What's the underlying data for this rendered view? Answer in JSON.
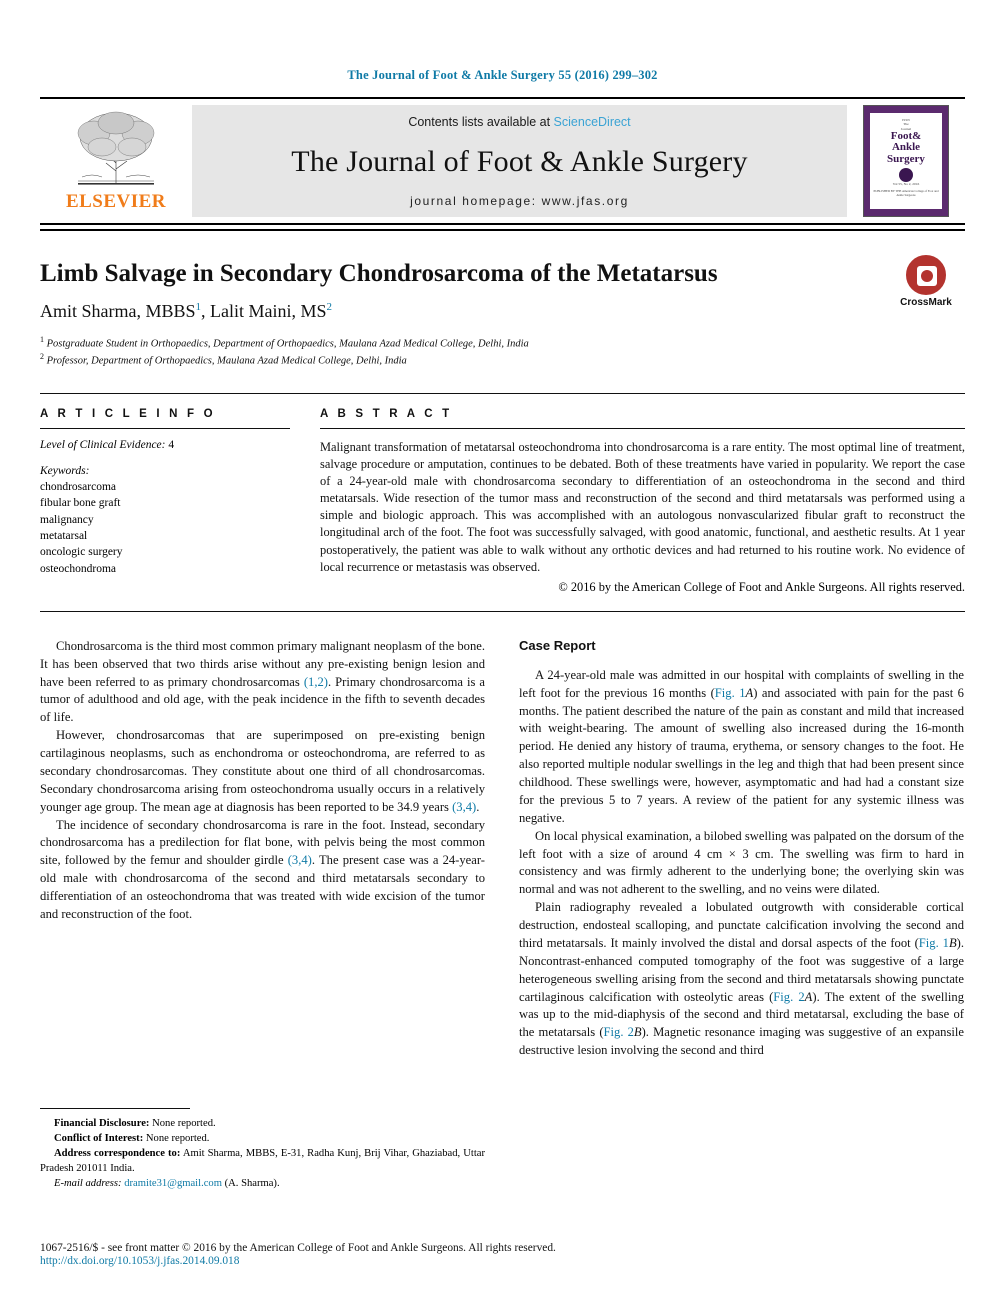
{
  "running_head": "The Journal of Foot & Ankle Surgery 55 (2016) 299–302",
  "masthead": {
    "publisher": "ELSEVIER",
    "contents_prefix": "Contents lists available at ",
    "contents_link": "ScienceDirect",
    "journal_title": "The Journal of Foot & Ankle Surgery",
    "homepage": "journal homepage: www.jfas.org",
    "cover": {
      "line_top": "ISSN",
      "t1": "The",
      "t2": "Journal",
      "t3": "of",
      "t4": "Foot&",
      "t5": "Ankle",
      "t6": "Surgery",
      "volume": "Vol 55, No 2, 2016",
      "footer": "PUBLISHED BY THE\nAmerican College of Foot and Ankle Surgeons"
    }
  },
  "article": {
    "title": "Limb Salvage in Secondary Chondrosarcoma of the Metatarsus",
    "authors_1": "Amit Sharma, MBBS",
    "authors_sup1": "1",
    "authors_sep": ", Lalit Maini, MS",
    "authors_sup2": "2",
    "affiliation_1_sup": "1",
    "affiliation_1": "Postgraduate Student in Orthopaedics, Department of Orthopaedics, Maulana Azad Medical College, Delhi, India",
    "affiliation_2_sup": "2",
    "affiliation_2": "Professor, Department of Orthopaedics, Maulana Azad Medical College, Delhi, India",
    "crossmark_label": "CrossMark"
  },
  "article_info": {
    "heading": "A R T I C L E   I N F O",
    "level_label": "Level of Clinical Evidence:",
    "level_value": " 4",
    "keywords_label": "Keywords:",
    "keywords": [
      "chondrosarcoma",
      "fibular bone graft",
      "malignancy",
      "metatarsal",
      "oncologic surgery",
      "osteochondroma"
    ]
  },
  "abstract": {
    "heading": "A B S T R A C T",
    "text": "Malignant transformation of metatarsal osteochondroma into chondrosarcoma is a rare entity. The most optimal line of treatment, salvage procedure or amputation, continues to be debated. Both of these treatments have varied in popularity. We report the case of a 24-year-old male with chondrosarcoma secondary to differentiation of an osteochondroma in the second and third metatarsals. Wide resection of the tumor mass and reconstruction of the second and third metatarsals was performed using a simple and biologic approach. This was accomplished with an autologous nonvascularized fibular graft to reconstruct the longitudinal arch of the foot. The foot was successfully salvaged, with good anatomic, functional, and aesthetic results. At 1 year postoperatively, the patient was able to walk without any orthotic devices and had returned to his routine work. No evidence of local recurrence or metastasis was observed.",
    "copyright": "© 2016 by the American College of Foot and Ankle Surgeons. All rights reserved."
  },
  "body": {
    "left_col": {
      "p1_a": "Chondrosarcoma is the third most common primary malignant neoplasm of the bone. It has been observed that two thirds arise without any pre-existing benign lesion and have been referred to as primary chondrosarcomas ",
      "p1_ref": "(1,2)",
      "p1_b": ". Primary chondrosarcoma is a tumor of adulthood and old age, with the peak incidence in the fifth to seventh decades of life.",
      "p2_a": "However, chondrosarcomas that are superimposed on pre-existing benign cartilaginous neoplasms, such as enchondroma or osteochondroma, are referred to as secondary chondrosarcomas. They constitute about one third of all chondrosarcomas. Secondary chondrosarcoma arising from osteochondroma usually occurs in a relatively younger age group. The mean age at diagnosis has been reported to be 34.9 years ",
      "p2_ref": "(3,4)",
      "p2_b": ".",
      "p3_a": "The incidence of secondary chondrosarcoma is rare in the foot. Instead, secondary chondrosarcoma has a predilection for flat bone, with pelvis being the most common site, followed by the femur and shoulder girdle ",
      "p3_ref": "(3,4)",
      "p3_b": ". The present case was a 24-year-old male with chondrosarcoma of the second and third metatarsals secondary to differentiation of an osteochondroma that was treated with wide excision of the tumor and reconstruction of the foot."
    },
    "right_col": {
      "section_title": "Case Report",
      "p1_a": "A 24-year-old male was admitted in our hospital with complaints of swelling in the left foot for the previous 16 months (",
      "p1_fig": "Fig. 1",
      "p1_figit": "A",
      "p1_b": ") and associated with pain for the past 6 months. The patient described the nature of the pain as constant and mild that increased with weight-bearing. The amount of swelling also increased during the 16-month period. He denied any history of trauma, erythema, or sensory changes to the foot. He also reported multiple nodular swellings in the leg and thigh that had been present since childhood. These swellings were, however, asymptomatic and had had a constant size for the previous 5 to 7 years. A review of the patient for any systemic illness was negative.",
      "p2": "On local physical examination, a bilobed swelling was palpated on the dorsum of the left foot with a size of around 4 cm × 3 cm. The swelling was firm to hard in consistency and was firmly adherent to the underlying bone; the overlying skin was normal and was not adherent to the swelling, and no veins were dilated.",
      "p3_a": "Plain radiography revealed a lobulated outgrowth with considerable cortical destruction, endosteal scalloping, and punctate calcification involving the second and third metatarsals. It mainly involved the distal and dorsal aspects of the foot (",
      "p3_fig1": "Fig. 1",
      "p3_fig1it": "B",
      "p3_b": "). Noncontrast-enhanced computed tomography of the foot was suggestive of a large heterogeneous swelling arising from the second and third metatarsals showing punctate cartilaginous calcification with osteolytic areas (",
      "p3_fig2": "Fig. 2",
      "p3_fig2it": "A",
      "p3_c": "). The extent of the swelling was up to the mid-diaphysis of the second and third metatarsal, excluding the base of the metatarsals (",
      "p3_fig3": "Fig. 2",
      "p3_fig3it": "B",
      "p3_d": "). Magnetic resonance imaging was suggestive of an expansile destructive lesion involving the second and third"
    }
  },
  "footnotes": {
    "financial_label": "Financial Disclosure:",
    "financial_value": " None reported.",
    "conflict_label": "Conflict of Interest:",
    "conflict_value": " None reported.",
    "address_label": "Address correspondence to:",
    "address_value": " Amit Sharma, MBBS, E-31, Radha Kunj, Brij Vihar, Ghaziabad, Uttar Pradesh 201011 India.",
    "email_label": "E-mail address:",
    "email_value": "dramite31@gmail.com",
    "email_suffix": " (A. Sharma)."
  },
  "page_footer": {
    "line1": "1067-2516/$ - see front matter © 2016 by the American College of Foot and Ankle Surgeons. All rights reserved.",
    "line2": "http://dx.doi.org/10.1053/j.jfas.2014.09.018"
  },
  "colors": {
    "link": "#0f7aa6",
    "sciencedirect": "#3aa3d4",
    "elsevier_orange": "#f07c1a",
    "crossmark_red": "#b3332e",
    "masthead_gray": "#e6e6e6"
  }
}
